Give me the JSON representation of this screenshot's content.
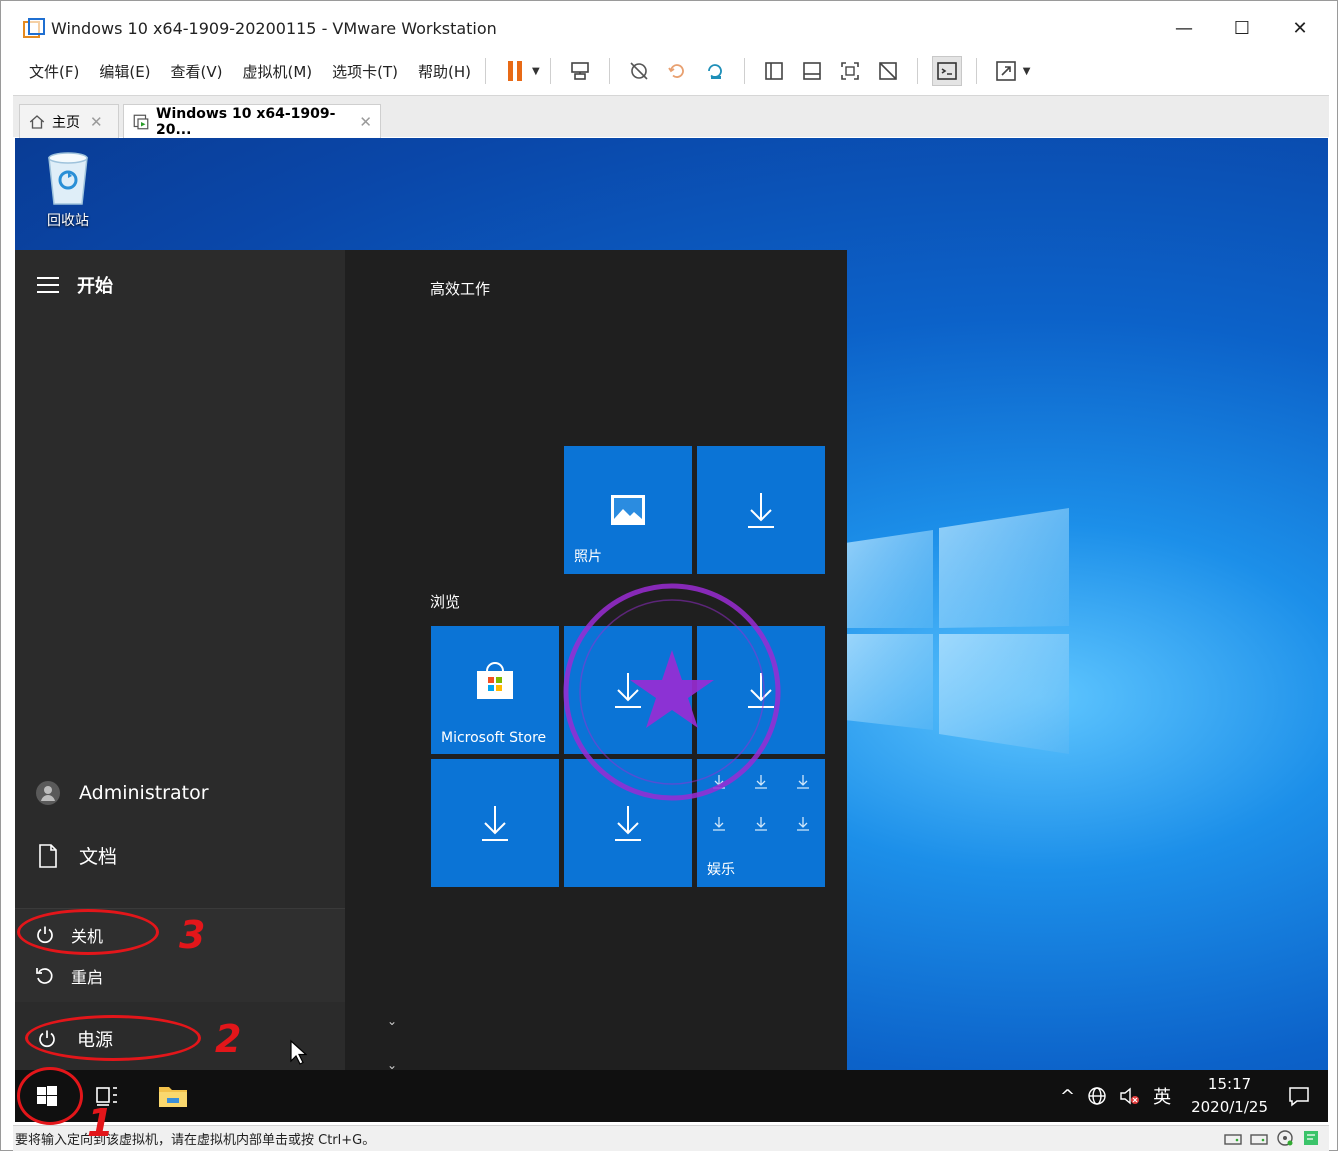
{
  "window": {
    "title": "Windows 10 x64-1909-20200115 - VMware Workstation",
    "controls": {
      "minimize": "—",
      "maximize": "☐",
      "close": "✕"
    }
  },
  "menu": [
    "文件(F)",
    "编辑(E)",
    "查看(V)",
    "虚拟机(M)",
    "选项卡(T)",
    "帮助(H)"
  ],
  "tabs": [
    {
      "label": "主页",
      "icon": "home-icon",
      "active": false
    },
    {
      "label": "Windows 10 x64-1909-20...",
      "icon": "vm-icon",
      "active": true
    }
  ],
  "desktop": {
    "recycle_bin_label": "回收站"
  },
  "start_menu": {
    "header": "开始",
    "user": "Administrator",
    "documents": "文档",
    "power_options": {
      "shutdown": "关机",
      "restart": "重启"
    },
    "power": "电源",
    "groups": [
      {
        "label": "高效工作"
      },
      {
        "label": "浏览"
      }
    ],
    "tiles": {
      "photos": "照片",
      "store": "Microsoft Store",
      "entertainment": "娱乐"
    }
  },
  "taskbar": {
    "time": "15:17",
    "date": "2020/1/25",
    "ime": "英"
  },
  "status_bar": {
    "text": "要将输入定向到该虚拟机，请在虚拟机内部单击或按 Ctrl+G。"
  },
  "annotations": [
    "1",
    "2",
    "3"
  ],
  "colors": {
    "accent_orange": "#e86a16",
    "tile_blue": "#0b74d6",
    "annotation_red": "#e3161a",
    "stamp_purple": "#9a2bd4"
  }
}
